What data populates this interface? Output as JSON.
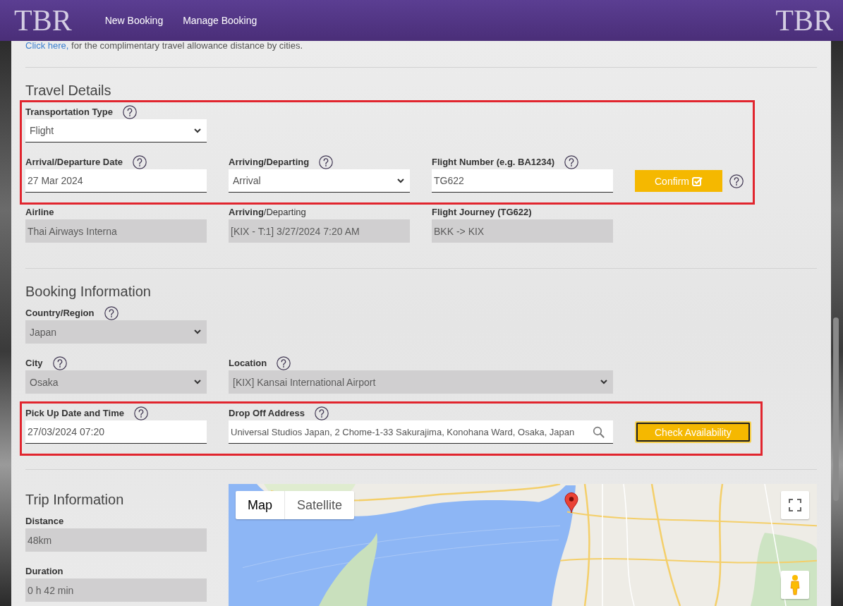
{
  "header": {
    "logo": "TBR",
    "nav": [
      {
        "label": "New Booking"
      },
      {
        "label": "Manage Booking"
      }
    ],
    "logo_right": "TBR"
  },
  "notice": {
    "link": "Click here,",
    "text": " for the complimentary travel allowance distance by cities."
  },
  "sections": [
    {
      "title": "Travel Details",
      "groups": [
        {
          "highlighted": true,
          "rows": [
            {
              "fields": [
                {
                  "kind": "select",
                  "label": "Transportation Type",
                  "help": true,
                  "disabled": false,
                  "value": "Flight"
                }
              ]
            },
            {
              "fields": [
                {
                  "kind": "input",
                  "label": "Arrival/Departure Date",
                  "help": true,
                  "disabled": false,
                  "value": "27 Mar 2024"
                },
                {
                  "kind": "select",
                  "label": "Arriving/Departing",
                  "help": true,
                  "disabled": false,
                  "value": "Arrival"
                },
                {
                  "kind": "input",
                  "label": "Flight Number (e.g. BA1234)",
                  "help": true,
                  "disabled": false,
                  "value": "TG622"
                },
                {
                  "kind": "icon-button",
                  "label": "Confirm",
                  "help": true,
                  "focused": false
                }
              ]
            }
          ]
        },
        {
          "highlighted": false,
          "rows": [
            {
              "fields": [
                {
                  "kind": "input",
                  "label": "Airline",
                  "help": false,
                  "disabled": true,
                  "value": "Thai Airways Interna"
                },
                {
                  "kind": "input",
                  "label": "**Arriving**/Departing",
                  "help": false,
                  "disabled": true,
                  "value": "[KIX - T:1] 3/27/2024 7:20 AM"
                },
                {
                  "kind": "input",
                  "label": "Flight Journey (TG622)",
                  "help": false,
                  "disabled": true,
                  "value": "BKK -> KIX"
                }
              ]
            }
          ]
        }
      ]
    },
    {
      "title": "Booking Information",
      "groups": [
        {
          "highlighted": false,
          "rows": [
            {
              "fields": [
                {
                  "kind": "select",
                  "label": "Country/Region",
                  "help": true,
                  "disabled": true,
                  "value": "Japan"
                }
              ]
            },
            {
              "fields": [
                {
                  "kind": "select",
                  "label": "City",
                  "help": true,
                  "disabled": true,
                  "value": "Osaka"
                },
                {
                  "kind": "select",
                  "label": "Location",
                  "help": true,
                  "disabled": true,
                  "value": "[KIX] Kansai International Airport"
                }
              ]
            }
          ]
        },
        {
          "highlighted": true,
          "rows": [
            {
              "fields": [
                {
                  "kind": "input",
                  "label": "Pick Up Date and Time",
                  "help": true,
                  "disabled": false,
                  "value": "27/03/2024 07:20"
                },
                {
                  "kind": "search",
                  "label": "Drop Off Address",
                  "help": true,
                  "disabled": false,
                  "value": "Universal Studios Japan, 2 Chome-1-33 Sakurajima, Konohana Ward, Osaka, Japan"
                },
                {
                  "kind": "button",
                  "label": "Check Availability",
                  "help": false,
                  "focused": true
                }
              ]
            }
          ]
        }
      ]
    }
  ],
  "trip_information": {
    "title": "Trip Information",
    "fields": [
      {
        "kind": "input",
        "label": "Distance",
        "help": false,
        "disabled": true,
        "value": "48km"
      },
      {
        "kind": "input",
        "label": "Duration",
        "help": false,
        "disabled": true,
        "value": "0 h 42 min"
      }
    ],
    "map": {
      "tabs": [
        {
          "label": "Map",
          "selected": true
        },
        {
          "label": "Satellite",
          "selected": false
        }
      ]
    }
  }
}
